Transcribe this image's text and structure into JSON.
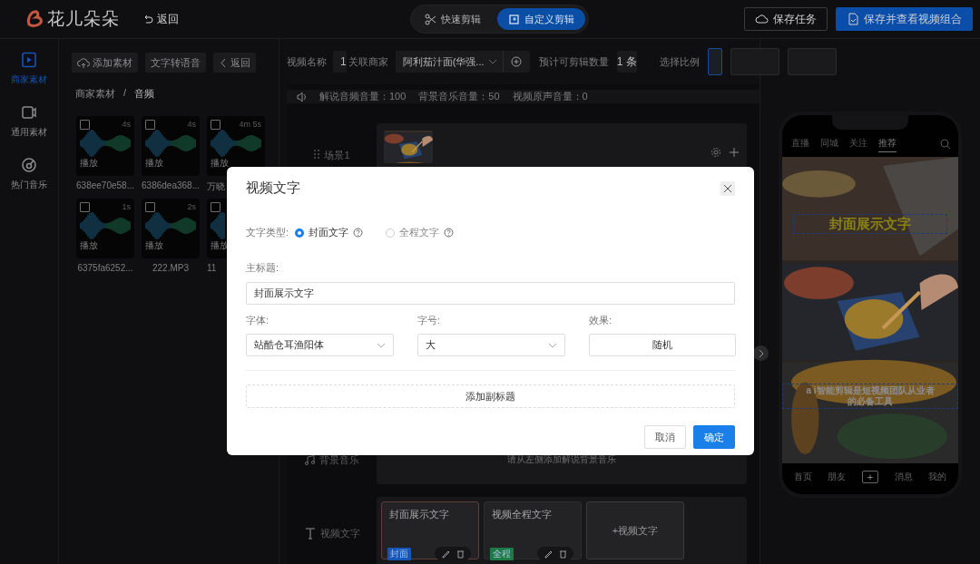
{
  "header": {
    "logo": "花儿朵朵",
    "back": "返回",
    "modes": [
      {
        "label": "快速剪辑",
        "selected": false
      },
      {
        "label": "自定义剪辑",
        "selected": true
      }
    ],
    "actions": [
      {
        "label": "保存任务",
        "kind": "outline"
      },
      {
        "label": "保存并查看视频组合",
        "kind": "primary"
      }
    ]
  },
  "nav": [
    {
      "label": "商家素材",
      "selected": true
    },
    {
      "label": "通用素材",
      "selected": false
    },
    {
      "label": "热门音乐",
      "selected": false
    }
  ],
  "materials": {
    "toolbar": [
      {
        "label": "添加素材"
      },
      {
        "label": "文字转语音"
      },
      {
        "label": "返回"
      }
    ],
    "breadcrumb": [
      "商家素材",
      "音频"
    ],
    "separator": "/",
    "items": [
      {
        "duration": "4s",
        "play": "播放",
        "name": "638ee70e58...",
        "checked": false
      },
      {
        "duration": "4s",
        "play": "播放",
        "name": "6386dea368...",
        "checked": false
      },
      {
        "duration": "4m 5s",
        "play": "播放",
        "name": "万晓",
        "checked": false
      },
      {
        "duration": "1s",
        "play": "播放",
        "name": "6375fa6252...",
        "checked": false
      },
      {
        "duration": "2s",
        "play": "播放",
        "name": "222.MP3",
        "checked": false
      },
      {
        "play": "播放",
        "name": "11",
        "checked": false
      }
    ]
  },
  "editor": {
    "name_label": "视频名称",
    "name_value": "1",
    "merchant_label": "关联商家",
    "merchant_value": "阿利茄汁面(华强...",
    "count_label": "预计可剪辑数量",
    "count_value": "1 条",
    "ratio_label": "选择比例",
    "ratios": [
      {
        "selected": true
      },
      {
        "selected": false
      },
      {
        "selected": false
      }
    ],
    "volumes": [
      "解说音频音量：100",
      "背景音乐音量：50",
      "视频原声音量：0"
    ],
    "scene": {
      "label": "场景1"
    },
    "bgm": {
      "label": "背景音乐",
      "hint": "请从左侧添加解说背景音乐"
    },
    "text_track": {
      "label": "视频文字",
      "add": "+视频文字",
      "cards": [
        {
          "title": "封面展示文字",
          "tag": "封面",
          "color": "#1356b8",
          "selected": true
        },
        {
          "title": "视频全程文字",
          "tag": "全程",
          "color": "#1d7a45",
          "selected": false
        }
      ]
    }
  },
  "preview": {
    "tabs": [
      {
        "label": "直播",
        "selected": false
      },
      {
        "label": "同城",
        "selected": false
      },
      {
        "label": "关注",
        "selected": false
      },
      {
        "label": "推荐",
        "selected": true
      }
    ],
    "cover_text": "封面展示文字",
    "caption": "a i智能剪辑是短视频团队从业者的必备工具",
    "bottom_nav": [
      "首页",
      "朋友",
      "+",
      "消息",
      "我的"
    ]
  },
  "modal": {
    "title": "视频文字",
    "type_label": "文字类型:",
    "types": [
      {
        "label": "封面文字",
        "selected": true
      },
      {
        "label": "全程文字",
        "selected": false
      }
    ],
    "title_label": "主标题:",
    "title_value": "封面展示文字",
    "font_label": "字体:",
    "font_value": "站酷仓耳渔阳体",
    "size_label": "字号:",
    "size_value": "大",
    "effect_label": "效果:",
    "effect_value": "随机",
    "add_subtitle": "添加副标题",
    "cancel": "取消",
    "confirm": "确定"
  }
}
